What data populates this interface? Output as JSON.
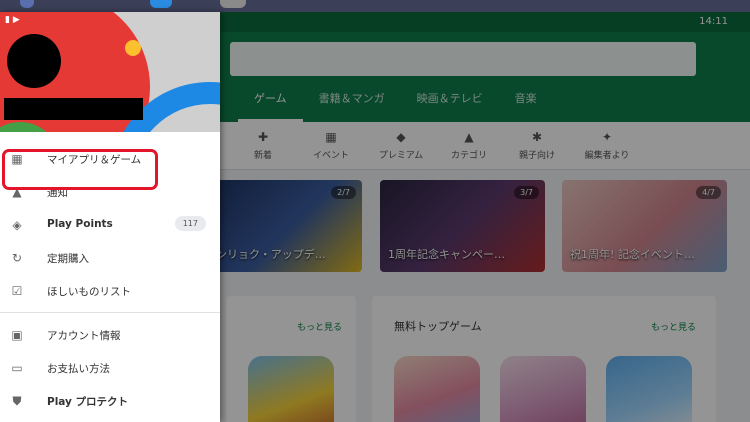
{
  "status": {
    "time": "14:11"
  },
  "app": {
    "top_tabs": [
      {
        "label": "ゲーム",
        "active": true
      },
      {
        "label": "書籍＆マンガ"
      },
      {
        "label": "映画＆テレビ"
      },
      {
        "label": "音楽"
      }
    ],
    "categories": [
      {
        "label": "新着",
        "icon": "new-icon",
        "glyph": "✚"
      },
      {
        "label": "イベント",
        "icon": "calendar-icon",
        "glyph": "▦"
      },
      {
        "label": "プレミアム",
        "icon": "diamond-icon",
        "glyph": "◆"
      },
      {
        "label": "カテゴリ",
        "icon": "shapes-icon",
        "glyph": "▲"
      },
      {
        "label": "親子向け",
        "icon": "family-icon",
        "glyph": "✱"
      },
      {
        "label": "編集者より",
        "icon": "bookmark-icon",
        "glyph": "✦"
      }
    ],
    "banners": [
      {
        "text": "ゼンリョク・アップデ…",
        "count": "2/7",
        "color": "#1e3a5f"
      },
      {
        "text": "1周年記念キャンペー…",
        "count": "3/7",
        "color": "#2b2a44"
      },
      {
        "text": "祝1周年! 記念イベント…",
        "count": "4/7",
        "color": "#c98a8e"
      }
    ],
    "cards": [
      {
        "title": "",
        "more": "もっと見る"
      },
      {
        "title": "無料トップゲーム",
        "more": "もっと見る"
      }
    ]
  },
  "drawer": {
    "menu": [
      {
        "label": "マイアプリ＆ゲーム",
        "icon": "apps-grid-icon",
        "glyph": "▦"
      },
      {
        "label": "通知",
        "icon": "bell-icon",
        "glyph": "🔔"
      },
      {
        "label": "Play Points",
        "icon": "play-points-icon",
        "glyph": "◈",
        "badge": "117"
      },
      {
        "label": "定期購入",
        "icon": "refresh-icon",
        "glyph": "↻"
      },
      {
        "label": "ほしいものリスト",
        "icon": "wishlist-icon",
        "glyph": "☑"
      },
      {
        "label": "アカウント情報",
        "icon": "account-icon",
        "glyph": "▣"
      },
      {
        "label": "お支払い方法",
        "icon": "credit-card-icon",
        "glyph": "▭"
      },
      {
        "label": "Play プロテクト",
        "icon": "shield-icon",
        "glyph": "⛊"
      }
    ],
    "highlight_color": "#e4142a"
  }
}
